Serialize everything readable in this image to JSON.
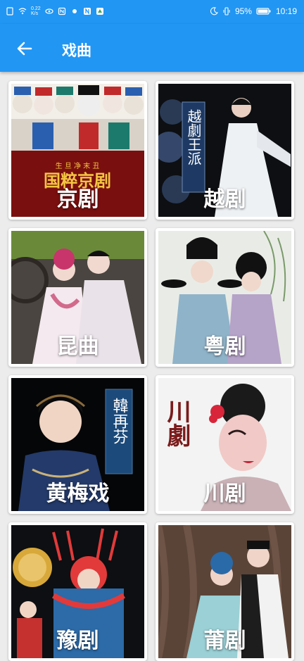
{
  "status_bar": {
    "battery": "95%",
    "time": "10:19",
    "speed": "0.22\nK/s"
  },
  "app_bar": {
    "title": "戏曲"
  },
  "items": [
    {
      "label": "京剧"
    },
    {
      "label": "越剧"
    },
    {
      "label": "昆曲"
    },
    {
      "label": "粤剧"
    },
    {
      "label": "黄梅戏"
    },
    {
      "label": "川剧"
    },
    {
      "label": "豫剧"
    },
    {
      "label": "莆剧"
    }
  ],
  "art_text": {
    "jingju_top": "生 旦 净 末 丑",
    "jingju_main": "国粹京剧",
    "yueju_vertical": "越劇王派",
    "huangmeixi_vertical": "韓再芬",
    "chuanju_vertical": "川劇"
  },
  "colors": {
    "primary": "#2196f3",
    "background": "#ececec"
  }
}
